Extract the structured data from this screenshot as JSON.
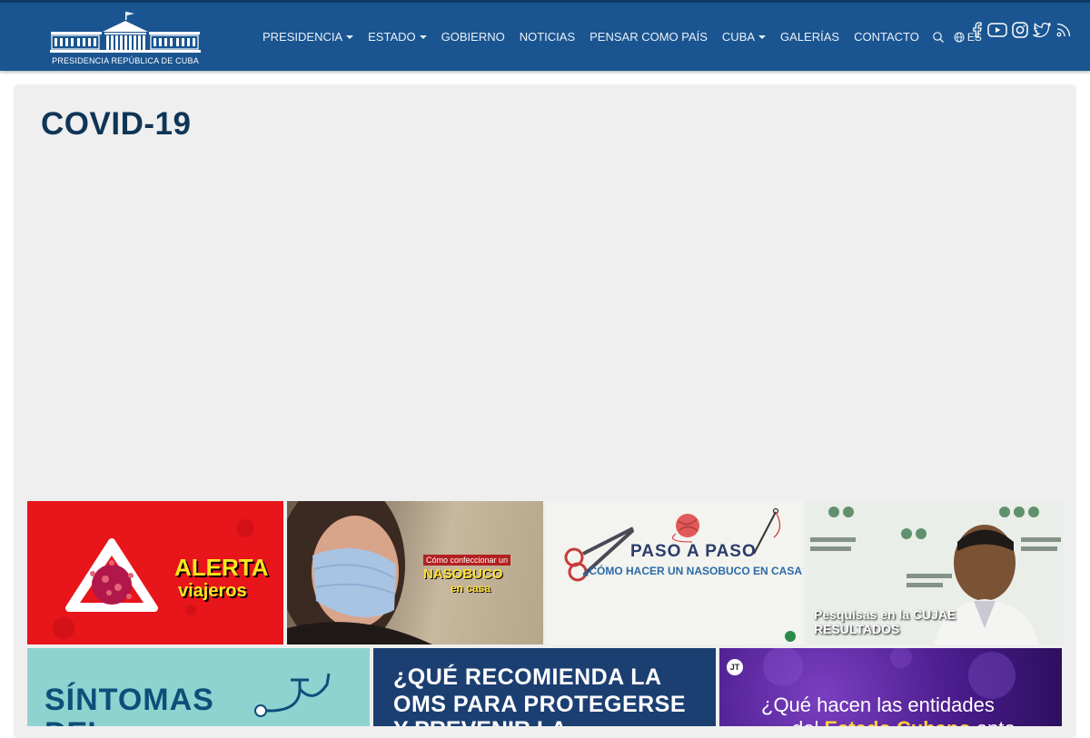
{
  "brand": {
    "logo_text": "PRESIDENCIA REPÚBLICA DE CUBA"
  },
  "nav": {
    "items": [
      {
        "label": "PRESIDENCIA",
        "dropdown": true
      },
      {
        "label": "ESTADO",
        "dropdown": true
      },
      {
        "label": "GOBIERNO",
        "dropdown": false
      },
      {
        "label": "NOTICIAS",
        "dropdown": false
      },
      {
        "label": "PENSAR COMO PAÍS",
        "dropdown": false
      },
      {
        "label": "CUBA",
        "dropdown": true
      },
      {
        "label": "GALERÍAS",
        "dropdown": false
      },
      {
        "label": "CONTACTO",
        "dropdown": false
      }
    ],
    "language": "ES",
    "socials": [
      "facebook-icon",
      "youtube-icon",
      "instagram-icon",
      "twitter-icon",
      "rss-icon"
    ]
  },
  "page": {
    "title": "COVID-19"
  },
  "tiles": {
    "t1": {
      "line1": "ALERTA",
      "line2": "viajeros"
    },
    "t2": {
      "line1": "Cómo confeccionar un",
      "line2": "NASOBUCO",
      "line3": "en casa"
    },
    "t3": {
      "line1": "PASO A PASO",
      "line2": "¿CÓMO HACER UN NASOBUCO EN CASA?"
    },
    "t4": {
      "line1": "Pesquisas en la CUJAE",
      "line2": "RESULTADOS"
    },
    "t5": {
      "line1": "SÍNTOMAS",
      "line2": "DEL"
    },
    "t6": {
      "line1": "¿QUÉ RECOMIENDA LA",
      "line2": "OMS PARA PROTEGERSE",
      "line3": "Y PREVENIR LA"
    },
    "t7": {
      "badge": "JT",
      "line1": "¿Qué hacen las entidades",
      "line2_pre": "del ",
      "line2_bold": "Estado Cubano",
      "line2_post": " ante"
    }
  },
  "colors": {
    "nav_bg": "#1a5591",
    "title": "#0f3556",
    "content_bg": "#efefef"
  }
}
